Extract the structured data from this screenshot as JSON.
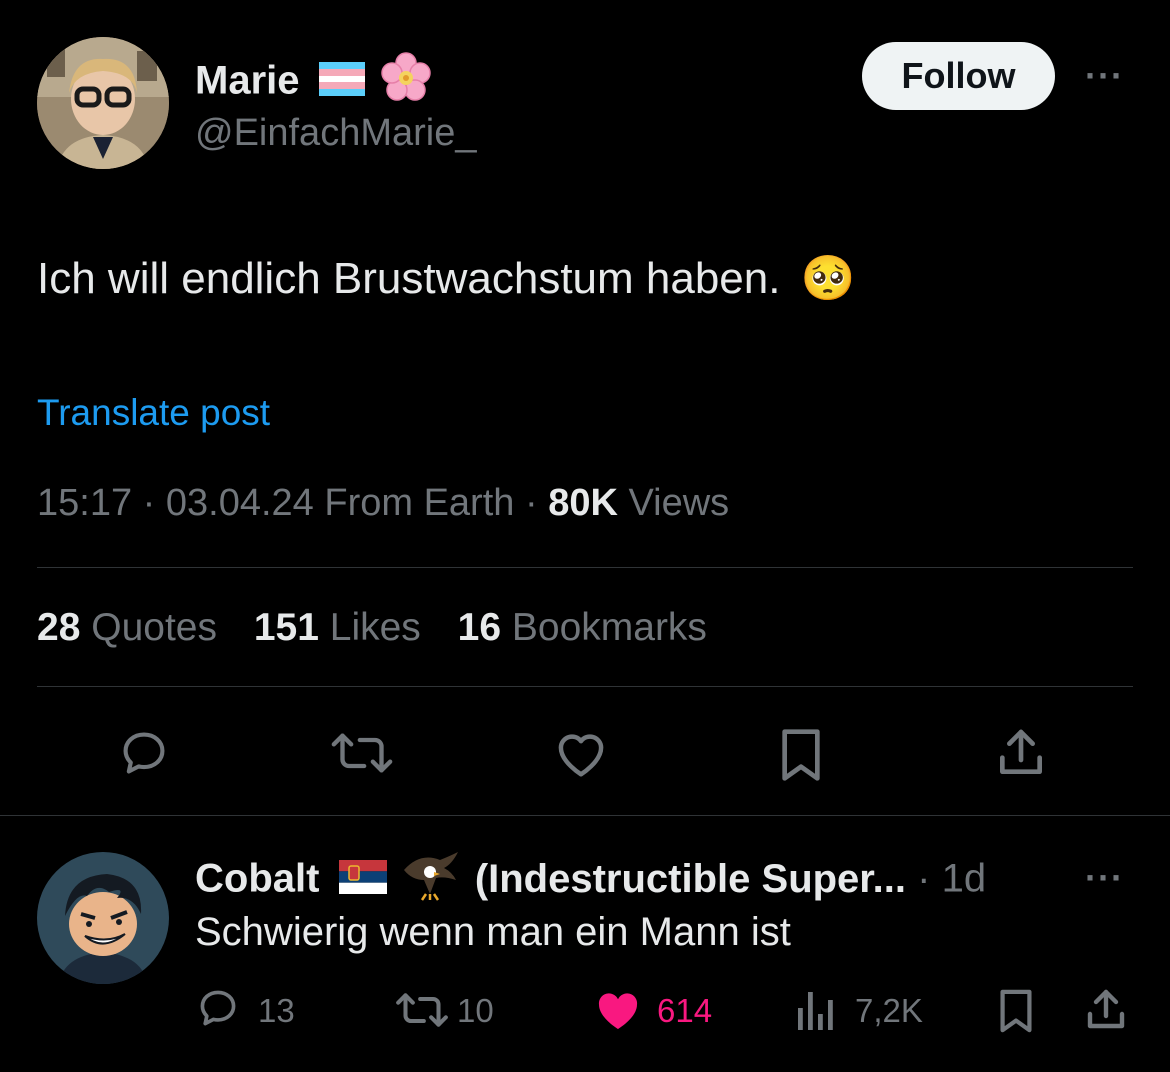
{
  "tweet": {
    "author_name": "Marie",
    "author_handle": "@EinfachMarie_",
    "follow_label": "Follow",
    "more_label": "···",
    "text": "Ich will endlich Brustwachstum haben.",
    "text_emoji": "🥺",
    "translate_label": "Translate post",
    "time": "15:17",
    "date": "03.04.24",
    "location": "From Earth",
    "sep": "·",
    "views_count": "80K",
    "views_label": "Views",
    "quotes_count": "28",
    "quotes_label": "Quotes",
    "likes_count": "151",
    "likes_label": "Likes",
    "bookmarks_count": "16",
    "bookmarks_label": "Bookmarks",
    "name_emojis": [
      "transgender-flag",
      "cherry-blossom"
    ]
  },
  "reply": {
    "author_name_start": "Cobalt",
    "author_name_rest": "(Indestructible Super...",
    "name_emojis": [
      "serbia-flag",
      "eagle"
    ],
    "sep": "·",
    "age": "1d",
    "more_label": "···",
    "text": "Schwierig wenn man ein Mann ist",
    "replies": "13",
    "reposts": "10",
    "likes": "614",
    "views": "7,2K"
  },
  "colors": {
    "background": "#000000",
    "text": "#e7e9ea",
    "secondary": "#71767b",
    "link": "#1d9bf0",
    "like_active": "#f91880",
    "divider": "#2f3336"
  }
}
